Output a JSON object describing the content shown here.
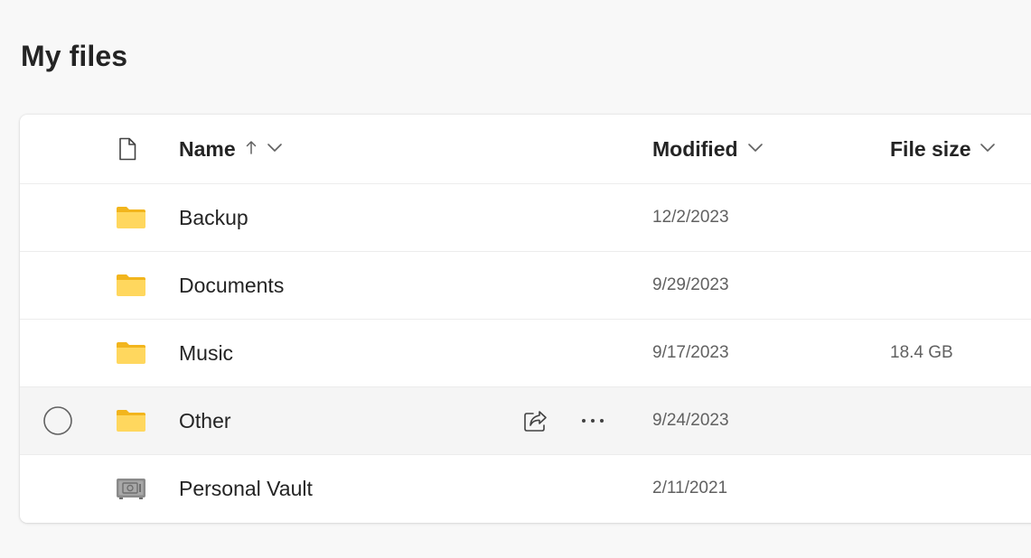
{
  "page": {
    "title": "My files"
  },
  "columns": {
    "name": "Name",
    "modified": "Modified",
    "size": "File size"
  },
  "rows": [
    {
      "name": "Backup",
      "modified": "12/2/2023",
      "size": "",
      "icon": "folder-icon"
    },
    {
      "name": "Documents",
      "modified": "9/29/2023",
      "size": "",
      "icon": "folder-icon"
    },
    {
      "name": "Music",
      "modified": "9/17/2023",
      "size": "18.4 GB",
      "icon": "folder-icon"
    },
    {
      "name": "Other",
      "modified": "9/24/2023",
      "size": "",
      "icon": "folder-icon",
      "hovered": true
    },
    {
      "name": "Personal Vault",
      "modified": "2/11/2021",
      "size": "",
      "icon": "vault-icon"
    }
  ],
  "colors": {
    "folder_body": "#FFD75E",
    "folder_tab": "#F2B51D",
    "hover_row": "#F5F5F5",
    "text_primary": "#242424",
    "text_secondary": "#616161"
  }
}
